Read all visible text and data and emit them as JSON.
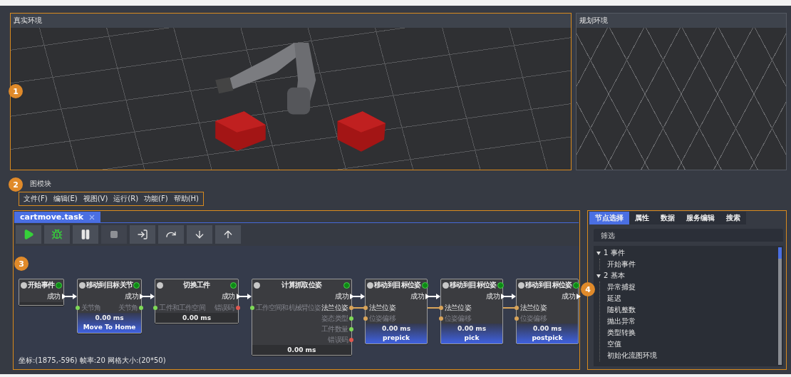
{
  "viewports": [
    {
      "title": "真实环境",
      "kind": "scene"
    },
    {
      "title": "规划环境",
      "kind": "grid"
    }
  ],
  "module_title": "图模块",
  "menu": [
    "文件(F)",
    "编辑(E)",
    "视图(V)",
    "运行(R)",
    "功能(F)",
    "帮助(H)"
  ],
  "editor": {
    "tab": {
      "label": "cartmove.task",
      "closable": true
    },
    "toolbar": [
      {
        "kind": "run",
        "disabled": false
      },
      {
        "kind": "debug",
        "disabled": false
      },
      {
        "kind": "pause",
        "disabled": false
      },
      {
        "kind": "stop",
        "disabled": true
      },
      {
        "kind": "enter",
        "disabled": false
      },
      {
        "kind": "step-over",
        "disabled": false
      },
      {
        "kind": "step-into",
        "disabled": false
      },
      {
        "kind": "step-out",
        "disabled": false
      }
    ],
    "nodes": [
      {
        "title": "开始事件",
        "flow_out": "成功"
      },
      {
        "title": "移动到目标关节",
        "flow_out": "成功",
        "inputs": [
          {
            "label": "关节角",
            "color": "#7ed957",
            "connected": false
          }
        ],
        "outputs": [
          {
            "label": "关节角",
            "color": "#7ed957",
            "connected": false
          }
        ],
        "time": "0.00 ms",
        "label": "Move To Home"
      },
      {
        "title": "切换工件",
        "flow_out": "成功",
        "inputs": [
          {
            "label": "工件和工作空间",
            "color": "#7ed957",
            "connected": false
          }
        ],
        "outputs": [
          {
            "label": "错误码",
            "color": "#e0574f",
            "connected": false
          }
        ],
        "time": "0.00 ms"
      },
      {
        "title": "计算抓取位姿",
        "flow_out": "成功",
        "inputs": [
          {
            "label": "工作空间和机械臂位姿",
            "color": "#7ed957",
            "connected": false
          }
        ],
        "outputs": [
          {
            "label": "法兰位姿",
            "color": "#d9a45a",
            "connected": true
          },
          {
            "label": "姿态类型",
            "color": "#7ed957",
            "connected": false
          },
          {
            "label": "工件数量",
            "color": "#7ed957",
            "connected": false
          },
          {
            "label": "错误码",
            "color": "#e0574f",
            "connected": false
          }
        ],
        "time": "0.00 ms"
      },
      {
        "title": "移动到目标位姿",
        "flow_out": "成功",
        "inputs": [
          {
            "label": "法兰位姿",
            "color": "#d9a45a",
            "connected": true
          },
          {
            "label": "位姿偏移",
            "color": "#d9a45a",
            "connected": false
          }
        ],
        "time": "0.00 ms",
        "label": "prepick"
      },
      {
        "title": "移动到目标位姿",
        "flow_out": "成功",
        "inputs": [
          {
            "label": "法兰位姿",
            "color": "#d9a45a",
            "connected": true
          },
          {
            "label": "位姿偏移",
            "color": "#d9a45a",
            "connected": false
          }
        ],
        "time": "0.00 ms",
        "label": "pick"
      },
      {
        "title": "移动到目标位姿",
        "flow_out": "成功",
        "inputs": [
          {
            "label": "法兰位姿",
            "color": "#d9a45a",
            "connected": true
          },
          {
            "label": "位姿偏移",
            "color": "#d9a45a",
            "connected": false
          }
        ],
        "time": "0.00 ms",
        "label": "postpick"
      }
    ],
    "status": "坐标:(1875,-596) 帧率:20 网格大小:(20*50)"
  },
  "panel": {
    "tabs": [
      {
        "label": "节点选择",
        "selected": true
      },
      {
        "label": "属性",
        "selected": false
      },
      {
        "label": "数据",
        "selected": false
      },
      {
        "label": "服务编辑",
        "selected": false
      },
      {
        "label": "搜索",
        "selected": false
      }
    ],
    "filter": {
      "placeholder": "筛选"
    },
    "tree": [
      {
        "label": "1 事件",
        "expanded": true,
        "children": [
          {
            "label": "开始事件"
          }
        ]
      },
      {
        "label": "2 基本",
        "expanded": true,
        "children": [
          {
            "label": "异常捕捉"
          },
          {
            "label": "延迟"
          },
          {
            "label": "随机整数"
          },
          {
            "label": "抛出异常"
          },
          {
            "label": "类型转换"
          },
          {
            "label": "空值"
          },
          {
            "label": "初始化流图环境"
          }
        ]
      }
    ]
  },
  "callouts": [
    "1",
    "2",
    "3",
    "4"
  ]
}
